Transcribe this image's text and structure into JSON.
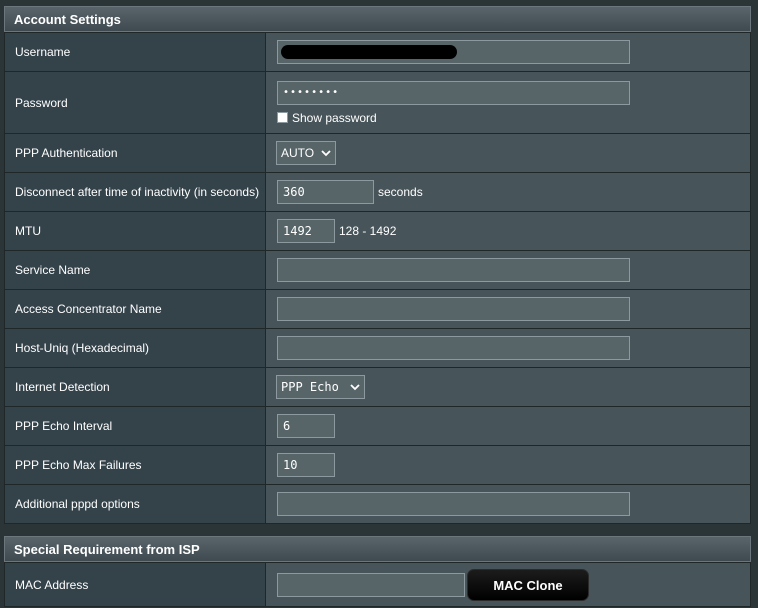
{
  "account_settings": {
    "title": "Account Settings",
    "username": {
      "label": "Username",
      "value": ""
    },
    "password": {
      "label": "Password",
      "value": "••••••••",
      "show_password_label": "Show password",
      "show_password_checked": false
    },
    "ppp_authentication": {
      "label": "PPP Authentication",
      "selected": "AUTO"
    },
    "disconnect_inactivity": {
      "label": "Disconnect after time of inactivity (in seconds)",
      "value": "360",
      "suffix": "seconds"
    },
    "mtu": {
      "label": "MTU",
      "value": "1492",
      "range": "128 - 1492"
    },
    "service_name": {
      "label": "Service Name",
      "value": ""
    },
    "access_concentrator": {
      "label": "Access Concentrator Name",
      "value": ""
    },
    "host_uniq": {
      "label": "Host-Uniq (Hexadecimal)",
      "value": ""
    },
    "internet_detection": {
      "label": "Internet Detection",
      "selected": "PPP Echo"
    },
    "ppp_echo_interval": {
      "label": "PPP Echo Interval",
      "value": "6"
    },
    "ppp_echo_max_failures": {
      "label": "PPP Echo Max Failures",
      "value": "10"
    },
    "additional_pppd": {
      "label": "Additional pppd options",
      "value": ""
    }
  },
  "special_requirement": {
    "title": "Special Requirement from ISP",
    "mac_address": {
      "label": "MAC Address",
      "value": ""
    },
    "mac_clone_label": "MAC Clone"
  },
  "icons": {
    "dropdown": "chevron-down-icon",
    "checkbox": "checkbox-icon"
  }
}
